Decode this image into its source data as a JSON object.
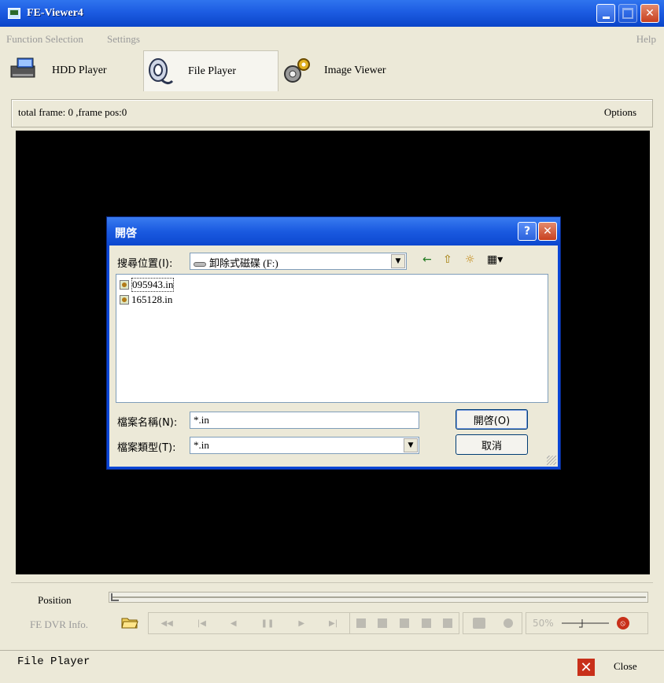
{
  "window": {
    "title": "FE-Viewer4",
    "close_glyph": "✕"
  },
  "menu": {
    "function_selection": "Function Selection",
    "settings": "Settings",
    "help": "Help"
  },
  "modes": [
    {
      "label": "HDD Player",
      "icon": "hdd-player-icon"
    },
    {
      "label": "File Player",
      "icon": "film-reel-icon"
    },
    {
      "label": "Image Viewer",
      "icon": "gears-icon"
    }
  ],
  "info": {
    "frame_text": "total frame: 0 ,frame pos:0",
    "options": "Options"
  },
  "dialog": {
    "title": "開啓",
    "help_glyph": "?",
    "close_glyph": "✕",
    "look_in_label": "搜尋位置(I):",
    "look_in_value": "卸除式磁碟 (F:)",
    "files": [
      "095943.in",
      "165128.in"
    ],
    "filename_label": "檔案名稱(N):",
    "filename_value": "*.in",
    "filetype_label": "檔案類型(T):",
    "filetype_value": "*.in",
    "open_button": "開啓(O)",
    "cancel_button": "取消",
    "toolbar_icons": {
      "back": "←",
      "up": "⇧",
      "new_folder": "☼",
      "views": "▦▾"
    }
  },
  "position": {
    "label": "Position",
    "value": 0
  },
  "controls": {
    "dvr_info": "FE DVR Info.",
    "volume": "50%",
    "transport": [
      "◀◀",
      "|◀",
      "◀",
      "❚❚",
      "▶",
      "▶|",
      "▶▶"
    ]
  },
  "status": {
    "text": "File Player",
    "close": "Close",
    "close_glyph": "✕"
  }
}
